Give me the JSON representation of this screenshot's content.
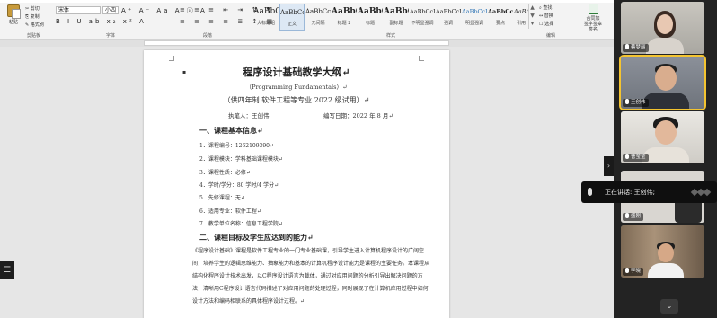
{
  "ribbon": {
    "paste_label": "粘贴",
    "clipboard_items": [
      "✂ 剪切",
      "⎘ 复制",
      "✎ 格式刷"
    ],
    "font_name": "宋体",
    "font_size": "小四",
    "format_row1": "A⁺ A⁻ Aa A ⓐ A",
    "format_row2": "B I U ab x₂ x² A",
    "para_row1": "≡ ≡ ≡ ⇤ ⇥ ⇅ ¶",
    "para_row2": "≡ ≡ ≡ ≡ ≣ ↕ ▦",
    "styles": [
      {
        "preview": "AaBbC",
        "name": "大标题组",
        "selected": false
      },
      {
        "preview": "AaBbCcI",
        "name": "正文",
        "selected": true
      },
      {
        "preview": "AaBbCcI",
        "name": "无间隔",
        "selected": false
      },
      {
        "preview": "AaBbC",
        "name": "标题 2",
        "selected": false
      },
      {
        "preview": "AaBbC",
        "name": "标题",
        "selected": false
      },
      {
        "preview": "AaBbC",
        "name": "副标题",
        "selected": false
      },
      {
        "preview": "AaBbCcD",
        "name": "不明显强调",
        "selected": false
      },
      {
        "preview": "AaBbCcD",
        "name": "强调",
        "selected": false
      },
      {
        "preview": "AaBbCcD",
        "name": "明显强调",
        "selected": false
      },
      {
        "preview": "AaBbCcD",
        "name": "要点",
        "selected": false
      },
      {
        "preview": "AaBbCcI",
        "name": "引用",
        "selected": false
      }
    ],
    "editing_items": [
      "⌕ 查找",
      "↔ 替换",
      "☐ 选择"
    ],
    "signature_label_1": "合同加",
    "signature_label_2": "签字签章",
    "signature_label_3": "签名",
    "group_labels": {
      "clipboard": "剪贴板",
      "font": "字体",
      "paragraph": "段落",
      "styles": "样式",
      "editing": "编辑"
    }
  },
  "document": {
    "title": "程序设计基础教学大纲↵",
    "subtitle": "（Programming Fundamentals）↵",
    "edition": "（供四年制 软件工程等专业 2022 级试用）↵",
    "author": "执笔人：王创伟",
    "date": "编写日期：2022 年 8 月↵",
    "section1": "一、课程基本信息↵",
    "items": [
      "1．课程编号：1262109390↵",
      "2．课程模块：学科基础课程模块↵",
      "3．课程性质：必修↵",
      "4．学时/学分：80 学时/4 学分↵",
      "5．先修课程：无↵",
      "6．适用专业：软件工程↵",
      "7．教学单位名称：信息工程学院↵"
    ],
    "section2": "二、课程目标及学生应达到的能力↵",
    "paragraph": "《程序设计基础》课程是软件工程专业的一门专业基础课，引导学生进入计算机程序设计的广阔空间，培养学生的逻辑思维能力、抽象能力和基本的计算机程序设计能力是课程的主要任务。本课程从结构化程序设计技术出发，以C程序设计语言为载体，通过对应用问题的分析引导出解决问题的方法，清晰用C程序设计语言代码描述了对应用问题的处理过程，同时展现了在计算机应用过程中如何设计方法和编码相联系的具体程序设计过程。↵"
  },
  "participants": [
    {
      "name": "蔡梦丽",
      "active": false
    },
    {
      "name": "王创伟",
      "active": true
    },
    {
      "name": "曹莹莹",
      "active": false
    },
    {
      "name": "盛刚",
      "active": false
    },
    {
      "name": "李晓",
      "active": false
    }
  ],
  "speaking": {
    "text": "正在讲话: 王创伟;"
  },
  "icons": {
    "left_tab": "list-icon",
    "side_arrow": "chevron-right-icon",
    "scroll": "chevron-down-icon"
  }
}
